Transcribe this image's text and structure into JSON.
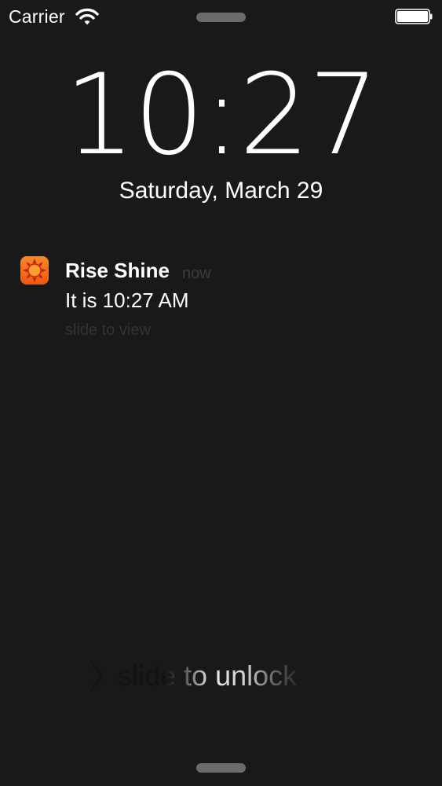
{
  "status_bar": {
    "carrier": "Carrier"
  },
  "lock_screen": {
    "time": "10:27",
    "date": "Saturday, March 29"
  },
  "notification": {
    "app_name": "Rise Shine",
    "timestamp": "now",
    "message": "It is 10:27 AM",
    "hint": "slide to view",
    "icon": "sun-icon",
    "icon_color": "#f0701a"
  },
  "unlock": {
    "label": "slide to unlock"
  },
  "colors": {
    "background": "#191919",
    "text": "#ffffff",
    "muted": "#3c3c3c"
  }
}
